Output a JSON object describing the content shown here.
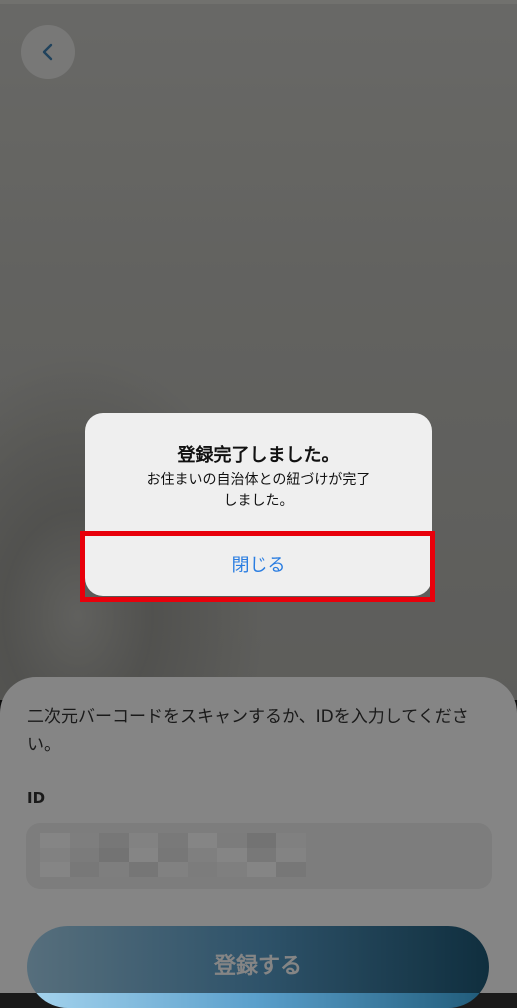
{
  "header": {
    "back_icon": "chevron-left-icon"
  },
  "sheet": {
    "instruction": "二次元バーコードをスキャンするか、IDを入力してください。",
    "id_label": "ID",
    "register_label": "登録する"
  },
  "alert": {
    "title": "登録完了しました。",
    "message_line1": "お住まいの自治体との紐づけが完了",
    "message_line2": "しました。",
    "close_label": "閉じる"
  },
  "colors": {
    "accent_blue": "#2a7de1",
    "highlight_red": "#e8000b",
    "button_gradient_start": "#a6d4ee",
    "button_gradient_end": "#1f5a78"
  }
}
